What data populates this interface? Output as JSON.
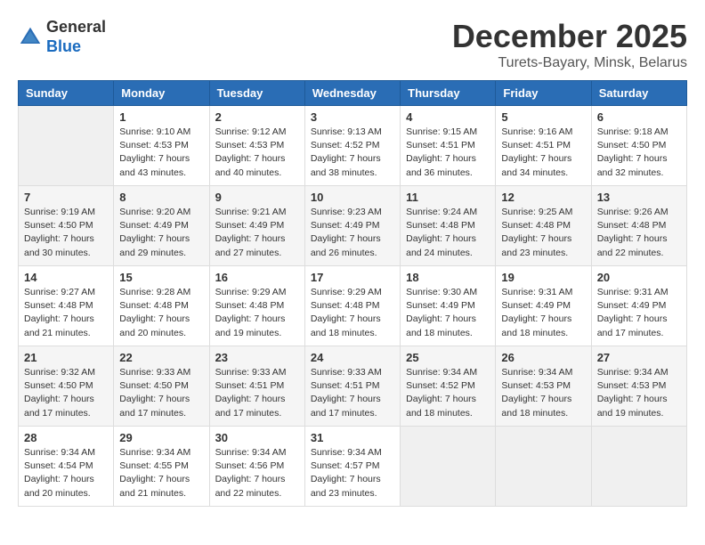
{
  "header": {
    "logo_general": "General",
    "logo_blue": "Blue",
    "month_title": "December 2025",
    "location": "Turets-Bayary, Minsk, Belarus"
  },
  "days_of_week": [
    "Sunday",
    "Monday",
    "Tuesday",
    "Wednesday",
    "Thursday",
    "Friday",
    "Saturday"
  ],
  "weeks": [
    [
      {
        "day": "",
        "info": ""
      },
      {
        "day": "1",
        "info": "Sunrise: 9:10 AM\nSunset: 4:53 PM\nDaylight: 7 hours\nand 43 minutes."
      },
      {
        "day": "2",
        "info": "Sunrise: 9:12 AM\nSunset: 4:53 PM\nDaylight: 7 hours\nand 40 minutes."
      },
      {
        "day": "3",
        "info": "Sunrise: 9:13 AM\nSunset: 4:52 PM\nDaylight: 7 hours\nand 38 minutes."
      },
      {
        "day": "4",
        "info": "Sunrise: 9:15 AM\nSunset: 4:51 PM\nDaylight: 7 hours\nand 36 minutes."
      },
      {
        "day": "5",
        "info": "Sunrise: 9:16 AM\nSunset: 4:51 PM\nDaylight: 7 hours\nand 34 minutes."
      },
      {
        "day": "6",
        "info": "Sunrise: 9:18 AM\nSunset: 4:50 PM\nDaylight: 7 hours\nand 32 minutes."
      }
    ],
    [
      {
        "day": "7",
        "info": "Sunrise: 9:19 AM\nSunset: 4:50 PM\nDaylight: 7 hours\nand 30 minutes."
      },
      {
        "day": "8",
        "info": "Sunrise: 9:20 AM\nSunset: 4:49 PM\nDaylight: 7 hours\nand 29 minutes."
      },
      {
        "day": "9",
        "info": "Sunrise: 9:21 AM\nSunset: 4:49 PM\nDaylight: 7 hours\nand 27 minutes."
      },
      {
        "day": "10",
        "info": "Sunrise: 9:23 AM\nSunset: 4:49 PM\nDaylight: 7 hours\nand 26 minutes."
      },
      {
        "day": "11",
        "info": "Sunrise: 9:24 AM\nSunset: 4:48 PM\nDaylight: 7 hours\nand 24 minutes."
      },
      {
        "day": "12",
        "info": "Sunrise: 9:25 AM\nSunset: 4:48 PM\nDaylight: 7 hours\nand 23 minutes."
      },
      {
        "day": "13",
        "info": "Sunrise: 9:26 AM\nSunset: 4:48 PM\nDaylight: 7 hours\nand 22 minutes."
      }
    ],
    [
      {
        "day": "14",
        "info": "Sunrise: 9:27 AM\nSunset: 4:48 PM\nDaylight: 7 hours\nand 21 minutes."
      },
      {
        "day": "15",
        "info": "Sunrise: 9:28 AM\nSunset: 4:48 PM\nDaylight: 7 hours\nand 20 minutes."
      },
      {
        "day": "16",
        "info": "Sunrise: 9:29 AM\nSunset: 4:48 PM\nDaylight: 7 hours\nand 19 minutes."
      },
      {
        "day": "17",
        "info": "Sunrise: 9:29 AM\nSunset: 4:48 PM\nDaylight: 7 hours\nand 18 minutes."
      },
      {
        "day": "18",
        "info": "Sunrise: 9:30 AM\nSunset: 4:49 PM\nDaylight: 7 hours\nand 18 minutes."
      },
      {
        "day": "19",
        "info": "Sunrise: 9:31 AM\nSunset: 4:49 PM\nDaylight: 7 hours\nand 18 minutes."
      },
      {
        "day": "20",
        "info": "Sunrise: 9:31 AM\nSunset: 4:49 PM\nDaylight: 7 hours\nand 17 minutes."
      }
    ],
    [
      {
        "day": "21",
        "info": "Sunrise: 9:32 AM\nSunset: 4:50 PM\nDaylight: 7 hours\nand 17 minutes."
      },
      {
        "day": "22",
        "info": "Sunrise: 9:33 AM\nSunset: 4:50 PM\nDaylight: 7 hours\nand 17 minutes."
      },
      {
        "day": "23",
        "info": "Sunrise: 9:33 AM\nSunset: 4:51 PM\nDaylight: 7 hours\nand 17 minutes."
      },
      {
        "day": "24",
        "info": "Sunrise: 9:33 AM\nSunset: 4:51 PM\nDaylight: 7 hours\nand 17 minutes."
      },
      {
        "day": "25",
        "info": "Sunrise: 9:34 AM\nSunset: 4:52 PM\nDaylight: 7 hours\nand 18 minutes."
      },
      {
        "day": "26",
        "info": "Sunrise: 9:34 AM\nSunset: 4:53 PM\nDaylight: 7 hours\nand 18 minutes."
      },
      {
        "day": "27",
        "info": "Sunrise: 9:34 AM\nSunset: 4:53 PM\nDaylight: 7 hours\nand 19 minutes."
      }
    ],
    [
      {
        "day": "28",
        "info": "Sunrise: 9:34 AM\nSunset: 4:54 PM\nDaylight: 7 hours\nand 20 minutes."
      },
      {
        "day": "29",
        "info": "Sunrise: 9:34 AM\nSunset: 4:55 PM\nDaylight: 7 hours\nand 21 minutes."
      },
      {
        "day": "30",
        "info": "Sunrise: 9:34 AM\nSunset: 4:56 PM\nDaylight: 7 hours\nand 22 minutes."
      },
      {
        "day": "31",
        "info": "Sunrise: 9:34 AM\nSunset: 4:57 PM\nDaylight: 7 hours\nand 23 minutes."
      },
      {
        "day": "",
        "info": ""
      },
      {
        "day": "",
        "info": ""
      },
      {
        "day": "",
        "info": ""
      }
    ]
  ]
}
